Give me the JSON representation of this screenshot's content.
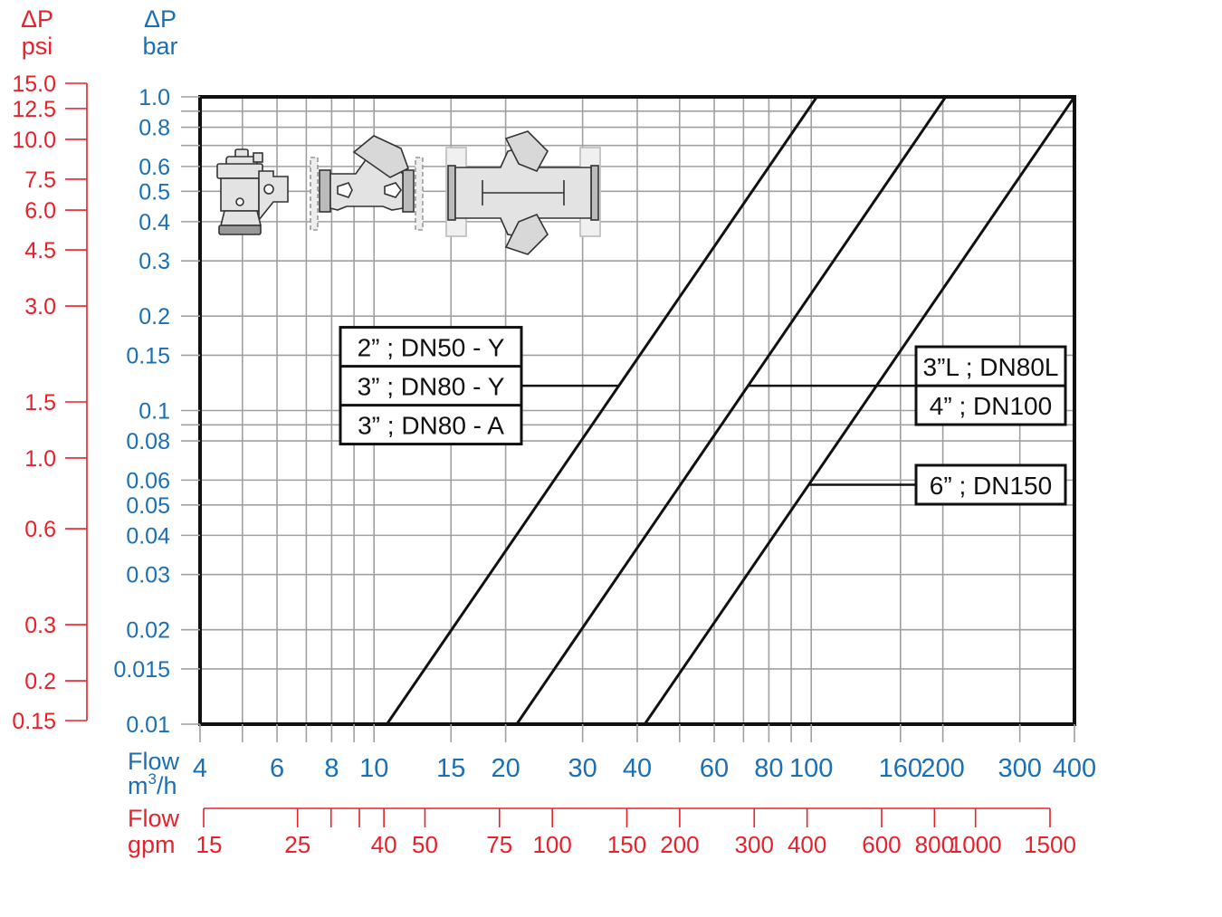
{
  "colors": {
    "bar_axis": "#1a6fb5",
    "psi_axis": "#e8212b",
    "grid": "#a0a0a0",
    "frame": "#111111"
  },
  "chart_data": {
    "type": "line",
    "title": "",
    "x_scale": "log",
    "y_scale": "log",
    "xlim": [
      4,
      400
    ],
    "ylim": [
      0.01,
      1.0
    ],
    "grid": true,
    "y_primary": {
      "title_line1": "ΔP",
      "title_line2": "bar",
      "unit": "bar",
      "ticks": [
        {
          "value": 1.0,
          "label": "1.0"
        },
        {
          "value": 0.9,
          "label": ""
        },
        {
          "value": 0.8,
          "label": "0.8"
        },
        {
          "value": 0.7,
          "label": ""
        },
        {
          "value": 0.6,
          "label": "0.6"
        },
        {
          "value": 0.5,
          "label": "0.5"
        },
        {
          "value": 0.4,
          "label": "0.4"
        },
        {
          "value": 0.3,
          "label": "0.3"
        },
        {
          "value": 0.2,
          "label": "0.2"
        },
        {
          "value": 0.15,
          "label": "0.15"
        },
        {
          "value": 0.1,
          "label": "0.1"
        },
        {
          "value": 0.09,
          "label": ""
        },
        {
          "value": 0.08,
          "label": "0.08"
        },
        {
          "value": 0.06,
          "label": "0.06"
        },
        {
          "value": 0.05,
          "label": "0.05"
        },
        {
          "value": 0.04,
          "label": "0.04"
        },
        {
          "value": 0.03,
          "label": "0.03"
        },
        {
          "value": 0.02,
          "label": "0.02"
        },
        {
          "value": 0.015,
          "label": "0.015"
        },
        {
          "value": 0.01,
          "label": "0.01"
        }
      ]
    },
    "y_secondary": {
      "title_line1": "ΔP",
      "title_line2": "psi",
      "unit": "psi",
      "range": [
        0.15,
        15.0
      ],
      "ticks": [
        {
          "value": 15.0,
          "label": "15.0"
        },
        {
          "value": 12.5,
          "label": "12.5"
        },
        {
          "value": 10.0,
          "label": "10.0"
        },
        {
          "value": 7.5,
          "label": "7.5"
        },
        {
          "value": 6.0,
          "label": "6.0"
        },
        {
          "value": 4.5,
          "label": "4.5"
        },
        {
          "value": 3.0,
          "label": "3.0"
        },
        {
          "value": 1.5,
          "label": "1.5"
        },
        {
          "value": 1.0,
          "label": "1.0"
        },
        {
          "value": 0.6,
          "label": "0.6"
        },
        {
          "value": 0.3,
          "label": "0.3"
        },
        {
          "value": 0.2,
          "label": "0.2"
        },
        {
          "value": 0.15,
          "label": "0.15"
        }
      ]
    },
    "x_primary": {
      "title_line1": "Flow",
      "title_line2": "m",
      "title_sup": "3",
      "title_line2_suffix": "/h",
      "unit": "m3/h",
      "ticks": [
        {
          "value": 4,
          "label": "4"
        },
        {
          "value": 5,
          "label": ""
        },
        {
          "value": 6,
          "label": "6"
        },
        {
          "value": 7,
          "label": ""
        },
        {
          "value": 8,
          "label": "8"
        },
        {
          "value": 9,
          "label": ""
        },
        {
          "value": 10,
          "label": "10"
        },
        {
          "value": 15,
          "label": "15"
        },
        {
          "value": 20,
          "label": "20"
        },
        {
          "value": 30,
          "label": "30"
        },
        {
          "value": 40,
          "label": "40"
        },
        {
          "value": 50,
          "label": ""
        },
        {
          "value": 60,
          "label": "60"
        },
        {
          "value": 70,
          "label": ""
        },
        {
          "value": 80,
          "label": "80"
        },
        {
          "value": 90,
          "label": ""
        },
        {
          "value": 100,
          "label": "100"
        },
        {
          "value": 160,
          "label": "160"
        },
        {
          "value": 200,
          "label": "200"
        },
        {
          "value": 300,
          "label": "300"
        },
        {
          "value": 400,
          "label": "400"
        }
      ]
    },
    "x_secondary": {
      "title_line1": "Flow",
      "title_line2": "gpm",
      "unit": "gpm",
      "range": [
        15,
        1500
      ],
      "ticks": [
        {
          "value": 15,
          "label": "15"
        },
        {
          "value": 25,
          "label": "25"
        },
        {
          "value": 30,
          "label": ""
        },
        {
          "value": 35,
          "label": ""
        },
        {
          "value": 40,
          "label": "40"
        },
        {
          "value": 50,
          "label": "50"
        },
        {
          "value": 75,
          "label": "75"
        },
        {
          "value": 100,
          "label": "100"
        },
        {
          "value": 150,
          "label": "150"
        },
        {
          "value": 200,
          "label": "200"
        },
        {
          "value": 300,
          "label": "300"
        },
        {
          "value": 400,
          "label": "400"
        },
        {
          "value": 600,
          "label": "600"
        },
        {
          "value": 800,
          "label": "800"
        },
        {
          "value": 1000,
          "label": "1000"
        },
        {
          "value": 1500,
          "label": "1500"
        }
      ]
    },
    "series": [
      {
        "name": "2\" ; DN50 - Y / 3\" ; DN80 - Y / 3\" ; DN80 - A",
        "points": [
          [
            10.7,
            0.01
          ],
          [
            103,
            1.0
          ]
        ],
        "callout_at_bar": 0.12,
        "labels": [
          "2” ; DN50 - Y",
          "3” ; DN80 - Y",
          "3” ; DN80 - A"
        ],
        "callout_side": "left"
      },
      {
        "name": "3\"L ; DN80L / 4\" ; DN100",
        "points": [
          [
            21.2,
            0.01
          ],
          [
            203,
            1.0
          ]
        ],
        "callout_at_bar": 0.12,
        "labels": [
          "3”L ; DN80L",
          "4” ; DN100"
        ],
        "callout_side": "right"
      },
      {
        "name": "6\" ; DN150",
        "points": [
          [
            41.6,
            0.01
          ],
          [
            400,
            1.0
          ]
        ],
        "callout_at_bar": 0.058,
        "labels": [
          "6” ; DN150"
        ],
        "callout_side": "right"
      }
    ],
    "illustrations": [
      "compact-valve-icon",
      "y-pattern-valve-icon",
      "angle-pattern-valve-icon"
    ]
  }
}
